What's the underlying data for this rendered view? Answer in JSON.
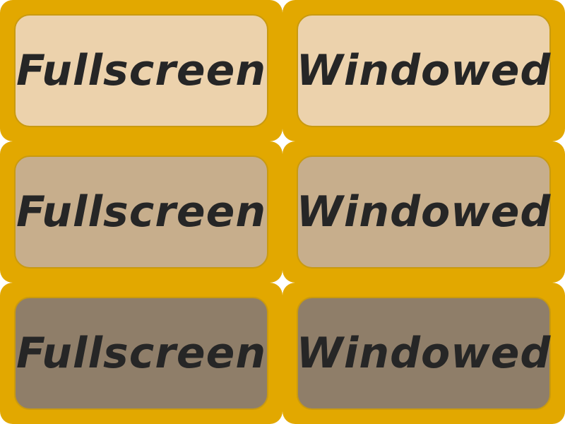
{
  "colors": {
    "frame": "#e2a800",
    "text": "#262626",
    "normal": "#ecd2ac",
    "hover": "#c7ae8c",
    "pressed": "#8f7e69"
  },
  "buttons": [
    {
      "label": "Fullscreen",
      "state": "normal"
    },
    {
      "label": "Windowed",
      "state": "normal"
    },
    {
      "label": "Fullscreen",
      "state": "hover"
    },
    {
      "label": "Windowed",
      "state": "hover"
    },
    {
      "label": "Fullscreen",
      "state": "pressed"
    },
    {
      "label": "Windowed",
      "state": "pressed"
    }
  ]
}
